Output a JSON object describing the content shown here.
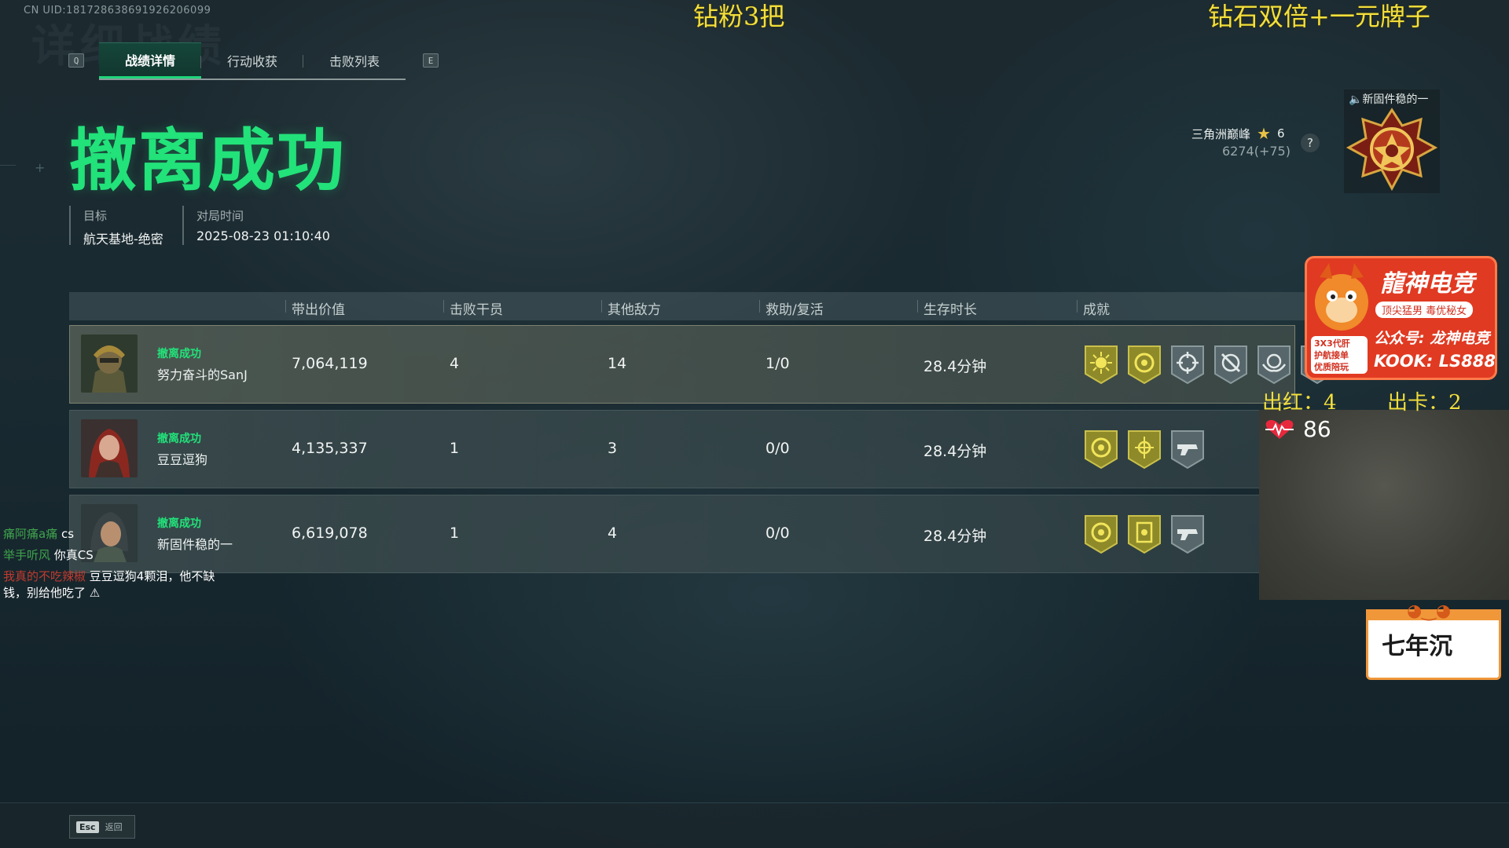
{
  "uid": "CN UID:18172863869192620609​9",
  "overlay": {
    "top_center": "钻粉3把",
    "top_right": "钻石双倍+一元牌子"
  },
  "tabs": [
    {
      "label": "战绩详情",
      "key": "Q",
      "active": true
    },
    {
      "label": "行动收获",
      "active": false
    },
    {
      "label": "击败列表",
      "key": "E",
      "active": false
    }
  ],
  "tab_keys": {
    "left": "Q",
    "right": "E"
  },
  "headline": "撤离成功",
  "meta": {
    "target_label": "目标",
    "target_value": "航天基地-绝密",
    "time_label": "对局时间",
    "time_value": "2025-08-23 01:10:40"
  },
  "rank": {
    "name": "三角洲巅峰",
    "stars": "6",
    "score": "6274(+75)",
    "help": "?",
    "badge_owner": "🔈新固件稳的一"
  },
  "table": {
    "headers": [
      "带出价值",
      "击败干员",
      "其他敌方",
      "救助/复活",
      "生存时长",
      "成就"
    ],
    "rows": [
      {
        "status": "撤离成功",
        "name": "努力奋斗的SanJ",
        "value": "7,064,119",
        "kills": "4",
        "others": "14",
        "assists": "1/0",
        "survival": "28.4分钟",
        "achievements": [
          "gold-sun-badge",
          "gold-ring-badge",
          "crosshair-badge",
          "crosshair-slash-badge",
          "wings-badge",
          "extra-badge"
        ]
      },
      {
        "status": "撤离成功",
        "name": "豆豆逗狗",
        "value": "4,135,337",
        "kills": "1",
        "others": "3",
        "assists": "0/0",
        "survival": "28.4分钟",
        "achievements": [
          "gold-ring-badge",
          "gold-compass-badge",
          "gun-badge"
        ]
      },
      {
        "status": "撤离成功",
        "name": "新固件稳的一",
        "value": "6,619,078",
        "kills": "1",
        "others": "4",
        "assists": "0/0",
        "survival": "28.4分钟",
        "achievements": [
          "gold-ring-badge",
          "gold-card-badge",
          "gun-badge"
        ]
      }
    ]
  },
  "chat": [
    {
      "user": "痛阿痛a痛",
      "msg": "cs"
    },
    {
      "user": "举手听风",
      "msg": "你真CS"
    },
    {
      "user": "我真的不吃辣椒",
      "msg": "豆豆逗狗4颗泪，他不缺"
    },
    {
      "user": "",
      "msg": "钱，别给他吃了"
    }
  ],
  "stream": {
    "ad_title": "龍神电竞",
    "ad_pill": "顶尖猛男 毒优秘女",
    "ad_line1": "公众号: 龙神电竞",
    "ad_line2": "KOOK: LS888",
    "ad_side": [
      "3X3代肝",
      "护航接单",
      "优质陪玩"
    ],
    "count_red": "出红：4",
    "count_card": "出卡：2",
    "heart_rate": "86",
    "sign": "七年沉"
  },
  "footer": {
    "esc_key": "Esc",
    "esc_label": "返回"
  },
  "colors": {
    "accent_green": "#22e27a",
    "overlay_yellow": "#f3df3c",
    "ad_red": "#e03a22"
  }
}
